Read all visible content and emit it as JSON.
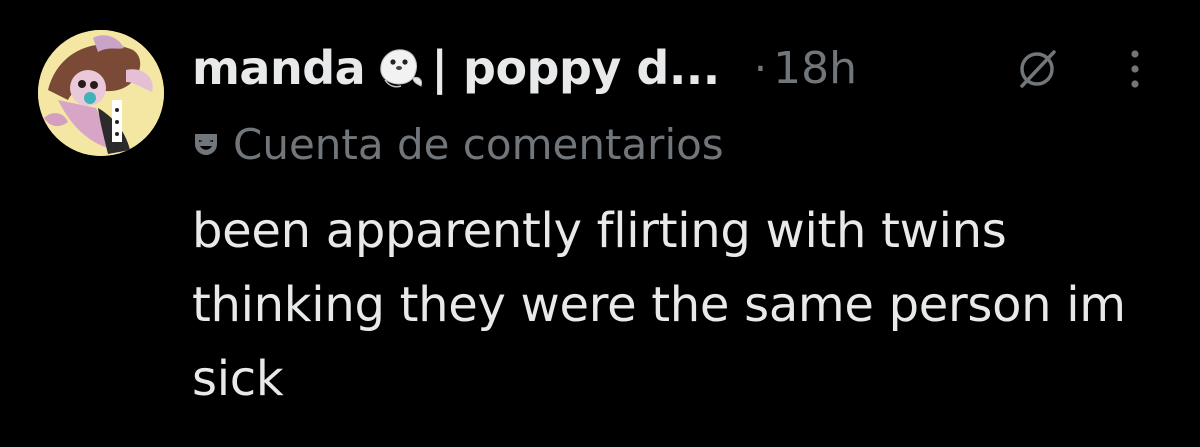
{
  "author": {
    "display_name": "manda",
    "name_rest": "| poppy d...",
    "emoji_icon": "seal-emoji-icon"
  },
  "meta": {
    "separator": "·",
    "timestamp": "18h"
  },
  "community": {
    "icon": "mask-icon",
    "label": "Cuenta de comentarios"
  },
  "post": {
    "text": "been apparently flirting with twins thinking they were the same person im sick"
  },
  "colors": {
    "background": "#000000",
    "primary_text": "#e7e9ea",
    "secondary_text": "#71767b"
  }
}
